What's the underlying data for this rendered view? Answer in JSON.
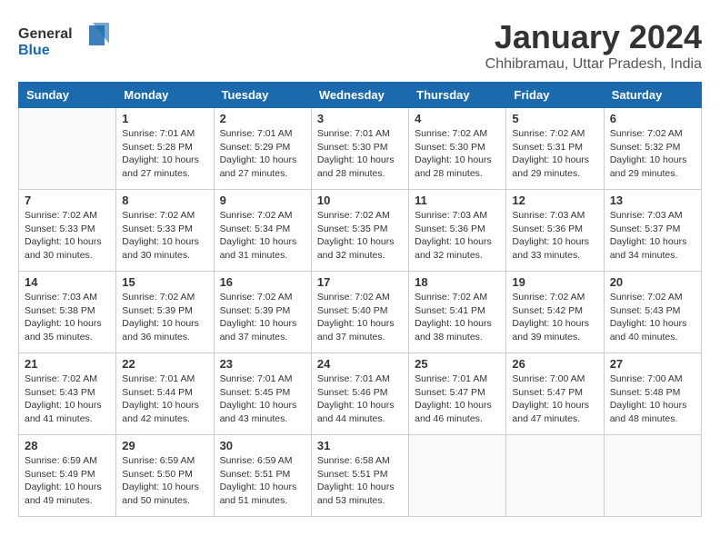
{
  "logo": {
    "line1": "General",
    "line2": "Blue"
  },
  "title": "January 2024",
  "location": "Chhibramau, Uttar Pradesh, India",
  "weekdays": [
    "Sunday",
    "Monday",
    "Tuesday",
    "Wednesday",
    "Thursday",
    "Friday",
    "Saturday"
  ],
  "weeks": [
    [
      {
        "day": "",
        "info": ""
      },
      {
        "day": "1",
        "info": "Sunrise: 7:01 AM\nSunset: 5:28 PM\nDaylight: 10 hours\nand 27 minutes."
      },
      {
        "day": "2",
        "info": "Sunrise: 7:01 AM\nSunset: 5:29 PM\nDaylight: 10 hours\nand 27 minutes."
      },
      {
        "day": "3",
        "info": "Sunrise: 7:01 AM\nSunset: 5:30 PM\nDaylight: 10 hours\nand 28 minutes."
      },
      {
        "day": "4",
        "info": "Sunrise: 7:02 AM\nSunset: 5:30 PM\nDaylight: 10 hours\nand 28 minutes."
      },
      {
        "day": "5",
        "info": "Sunrise: 7:02 AM\nSunset: 5:31 PM\nDaylight: 10 hours\nand 29 minutes."
      },
      {
        "day": "6",
        "info": "Sunrise: 7:02 AM\nSunset: 5:32 PM\nDaylight: 10 hours\nand 29 minutes."
      }
    ],
    [
      {
        "day": "7",
        "info": "Sunrise: 7:02 AM\nSunset: 5:33 PM\nDaylight: 10 hours\nand 30 minutes."
      },
      {
        "day": "8",
        "info": "Sunrise: 7:02 AM\nSunset: 5:33 PM\nDaylight: 10 hours\nand 30 minutes."
      },
      {
        "day": "9",
        "info": "Sunrise: 7:02 AM\nSunset: 5:34 PM\nDaylight: 10 hours\nand 31 minutes."
      },
      {
        "day": "10",
        "info": "Sunrise: 7:02 AM\nSunset: 5:35 PM\nDaylight: 10 hours\nand 32 minutes."
      },
      {
        "day": "11",
        "info": "Sunrise: 7:03 AM\nSunset: 5:36 PM\nDaylight: 10 hours\nand 32 minutes."
      },
      {
        "day": "12",
        "info": "Sunrise: 7:03 AM\nSunset: 5:36 PM\nDaylight: 10 hours\nand 33 minutes."
      },
      {
        "day": "13",
        "info": "Sunrise: 7:03 AM\nSunset: 5:37 PM\nDaylight: 10 hours\nand 34 minutes."
      }
    ],
    [
      {
        "day": "14",
        "info": "Sunrise: 7:03 AM\nSunset: 5:38 PM\nDaylight: 10 hours\nand 35 minutes."
      },
      {
        "day": "15",
        "info": "Sunrise: 7:02 AM\nSunset: 5:39 PM\nDaylight: 10 hours\nand 36 minutes."
      },
      {
        "day": "16",
        "info": "Sunrise: 7:02 AM\nSunset: 5:39 PM\nDaylight: 10 hours\nand 37 minutes."
      },
      {
        "day": "17",
        "info": "Sunrise: 7:02 AM\nSunset: 5:40 PM\nDaylight: 10 hours\nand 37 minutes."
      },
      {
        "day": "18",
        "info": "Sunrise: 7:02 AM\nSunset: 5:41 PM\nDaylight: 10 hours\nand 38 minutes."
      },
      {
        "day": "19",
        "info": "Sunrise: 7:02 AM\nSunset: 5:42 PM\nDaylight: 10 hours\nand 39 minutes."
      },
      {
        "day": "20",
        "info": "Sunrise: 7:02 AM\nSunset: 5:43 PM\nDaylight: 10 hours\nand 40 minutes."
      }
    ],
    [
      {
        "day": "21",
        "info": "Sunrise: 7:02 AM\nSunset: 5:43 PM\nDaylight: 10 hours\nand 41 minutes."
      },
      {
        "day": "22",
        "info": "Sunrise: 7:01 AM\nSunset: 5:44 PM\nDaylight: 10 hours\nand 42 minutes."
      },
      {
        "day": "23",
        "info": "Sunrise: 7:01 AM\nSunset: 5:45 PM\nDaylight: 10 hours\nand 43 minutes."
      },
      {
        "day": "24",
        "info": "Sunrise: 7:01 AM\nSunset: 5:46 PM\nDaylight: 10 hours\nand 44 minutes."
      },
      {
        "day": "25",
        "info": "Sunrise: 7:01 AM\nSunset: 5:47 PM\nDaylight: 10 hours\nand 46 minutes."
      },
      {
        "day": "26",
        "info": "Sunrise: 7:00 AM\nSunset: 5:47 PM\nDaylight: 10 hours\nand 47 minutes."
      },
      {
        "day": "27",
        "info": "Sunrise: 7:00 AM\nSunset: 5:48 PM\nDaylight: 10 hours\nand 48 minutes."
      }
    ],
    [
      {
        "day": "28",
        "info": "Sunrise: 6:59 AM\nSunset: 5:49 PM\nDaylight: 10 hours\nand 49 minutes."
      },
      {
        "day": "29",
        "info": "Sunrise: 6:59 AM\nSunset: 5:50 PM\nDaylight: 10 hours\nand 50 minutes."
      },
      {
        "day": "30",
        "info": "Sunrise: 6:59 AM\nSunset: 5:51 PM\nDaylight: 10 hours\nand 51 minutes."
      },
      {
        "day": "31",
        "info": "Sunrise: 6:58 AM\nSunset: 5:51 PM\nDaylight: 10 hours\nand 53 minutes."
      },
      {
        "day": "",
        "info": ""
      },
      {
        "day": "",
        "info": ""
      },
      {
        "day": "",
        "info": ""
      }
    ]
  ]
}
